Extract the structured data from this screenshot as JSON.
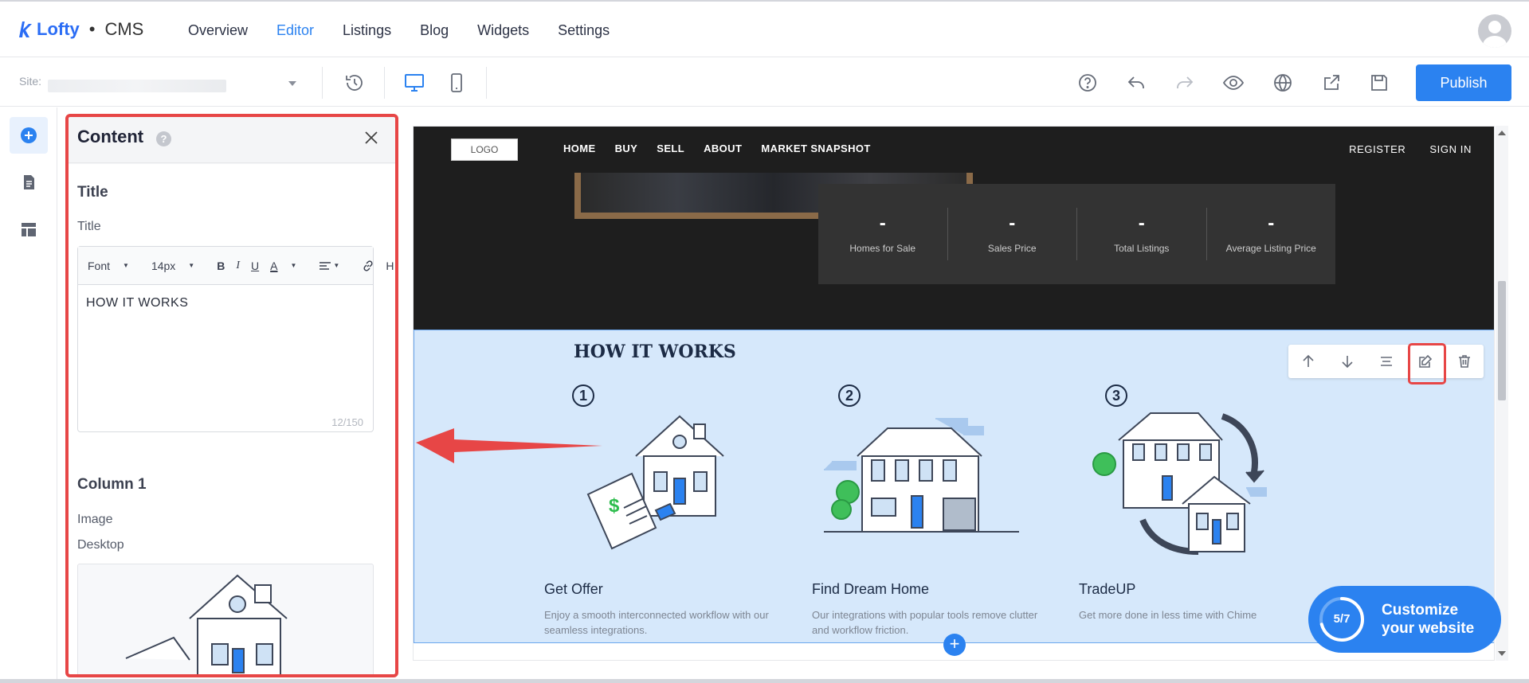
{
  "app": {
    "brand": "Lofty",
    "separator": "•",
    "product": "CMS"
  },
  "nav": {
    "tabs": [
      {
        "label": "Overview"
      },
      {
        "label": "Editor"
      },
      {
        "label": "Listings"
      },
      {
        "label": "Blog"
      },
      {
        "label": "Widgets"
      },
      {
        "label": "Settings"
      }
    ],
    "active": "Editor"
  },
  "toolbar": {
    "site_label": "Site:",
    "publish_label": "Publish",
    "icons": [
      "history-icon",
      "desktop-icon",
      "mobile-icon",
      "help-icon",
      "undo-icon",
      "redo-icon",
      "preview-icon",
      "domain-icon",
      "export-icon",
      "save-icon"
    ]
  },
  "rail": {
    "icons": [
      "add-icon",
      "pages-icon",
      "layout-icon"
    ]
  },
  "panel": {
    "title": "Content",
    "help": "?",
    "section_title": "Title",
    "title_field_label": "Title",
    "editor": {
      "font_label": "Font",
      "size_label": "14px",
      "bold": "B",
      "italic": "I",
      "underline": "U",
      "color": "A",
      "heading": "H",
      "value": "HOW IT WORKS",
      "count": "12/150"
    },
    "column_title": "Column 1",
    "image_label": "Image",
    "desktop_label": "Desktop"
  },
  "site": {
    "logo": "LOGO",
    "links": [
      "HOME",
      "BUY",
      "SELL",
      "ABOUT",
      "MARKET SNAPSHOT"
    ],
    "register": "REGISTER",
    "signin": "SIGN IN",
    "stats": [
      {
        "value": "-",
        "label": "Homes for Sale"
      },
      {
        "value": "-",
        "label": "Sales Price"
      },
      {
        "value": "-",
        "label": "Total Listings"
      },
      {
        "value": "-",
        "label": "Average Listing Price"
      }
    ],
    "how": {
      "title": "HOW IT WORKS",
      "steps": [
        {
          "num": "1",
          "title": "Get Offer",
          "desc": "Enjoy a smooth interconnected workflow with our seamless integrations."
        },
        {
          "num": "2",
          "title": "Find Dream Home",
          "desc": "Our integrations with popular tools remove clutter and workflow friction."
        },
        {
          "num": "3",
          "title": "TradeUP",
          "desc": "Get more done in less time with Chime"
        }
      ]
    },
    "add": "+"
  },
  "customize": {
    "progress": "5/7",
    "progress_fraction": 0.71,
    "line1": "Customize",
    "line2": "your website"
  }
}
